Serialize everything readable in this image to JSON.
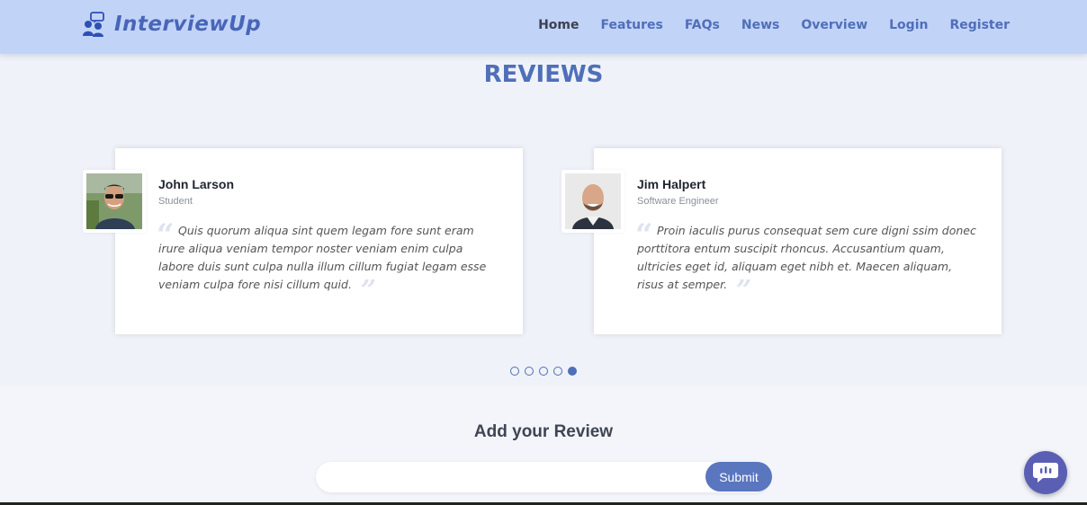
{
  "header": {
    "brand": "InterviewUp",
    "nav": [
      "Home",
      "Features",
      "FAQs",
      "News",
      "Overview",
      "Login",
      "Register"
    ],
    "active_nav": "Home"
  },
  "reviews": {
    "title": "REVIEWS",
    "items": [
      {
        "name": "John Larson",
        "role": "Student",
        "text": "Quis quorum aliqua sint quem legam fore sunt eram irure aliqua veniam tempor noster veniam enim culpa labore duis sunt culpa nulla illum cillum fugiat legam esse veniam culpa fore nisi cillum quid."
      },
      {
        "name": "Jim Halpert",
        "role": "Software Engineer",
        "text": "Proin iaculis purus consequat sem cure digni ssim donec porttitora entum suscipit rhoncus. Accusantium quam, ultricies eget id, aliquam eget nibh et. Maecen aliquam, risus at semper."
      }
    ],
    "dots_total": 5,
    "dots_active_index": 4
  },
  "add_review": {
    "title": "Add your Review",
    "input_placeholder": "",
    "submit_label": "Submit"
  },
  "colors": {
    "header_bg": "#c2d3f8",
    "accent": "#4f6fb9",
    "button": "#5a76bf",
    "chat_button": "#5a5fb4"
  },
  "icons": {
    "brand": "interview-people-icon",
    "chat": "chat-bubble-icon"
  }
}
